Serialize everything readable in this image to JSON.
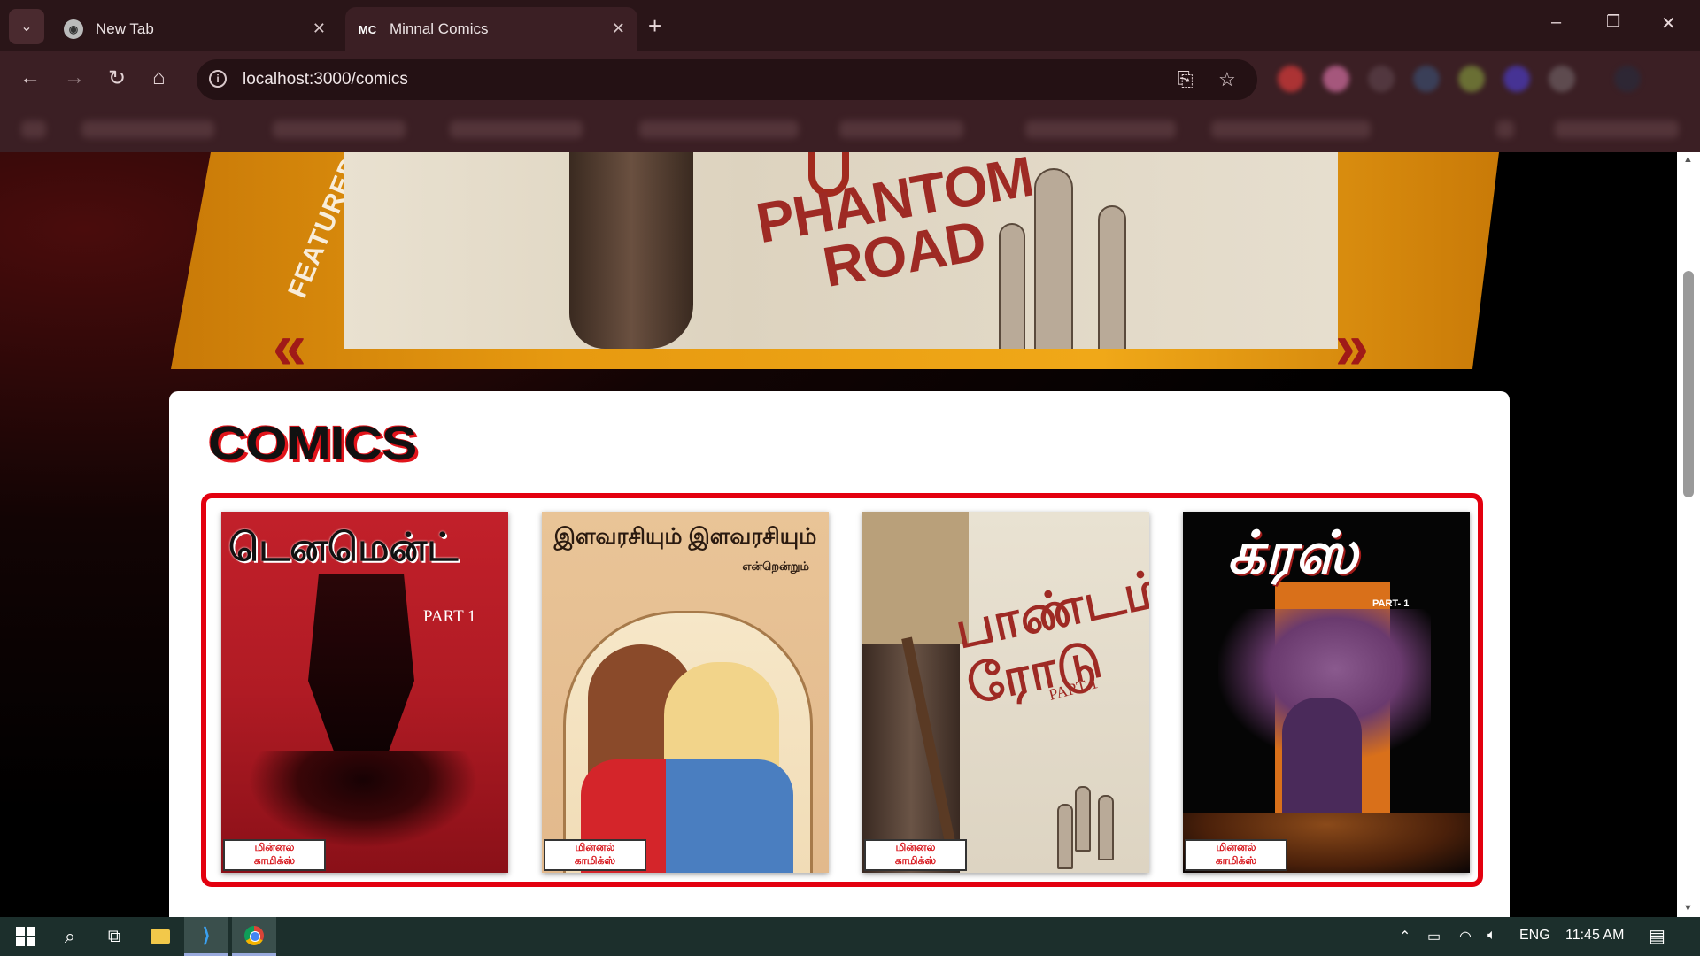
{
  "browser": {
    "tabs": [
      {
        "title": "New Tab",
        "favicon": "chrome-icon",
        "active": false
      },
      {
        "title": "Minnal Comics",
        "favicon_text": "MC",
        "active": true
      }
    ],
    "url": "localhost:3000/comics",
    "window_controls": {
      "minimize": "–",
      "restore": "❐",
      "close": "✕"
    }
  },
  "banner": {
    "side_text": "FEATURED NEWS",
    "title_line1": "PHANTOM",
    "title_line2": "ROAD"
  },
  "comics_section": {
    "title": "COMICS",
    "comics": [
      {
        "title": "டெனமென்ட்",
        "part": "PART 1",
        "badge": [
          "மின்னல்",
          "காமிக்ஸ்"
        ]
      },
      {
        "title": "இளவரசியும் இளவரசியும்",
        "subtitle": "என்றென்றும்",
        "badge": [
          "மின்னல்",
          "காமிக்ஸ்"
        ]
      },
      {
        "title": "பாண்டம் ரோடு",
        "part": "PART 1",
        "badge": [
          "மின்னல்",
          "காமிக்ஸ்"
        ]
      },
      {
        "title": "க்ரஸ்",
        "part": "PART- 1",
        "badge": [
          "மின்னல்",
          "காமிக்ஸ்"
        ]
      }
    ]
  },
  "taskbar": {
    "language": "ENG",
    "time": "11:45 AM"
  },
  "colors": {
    "accent_red": "#e3000f",
    "banner_orange": "#e79a10",
    "browser_frame": "#3b1f24"
  }
}
